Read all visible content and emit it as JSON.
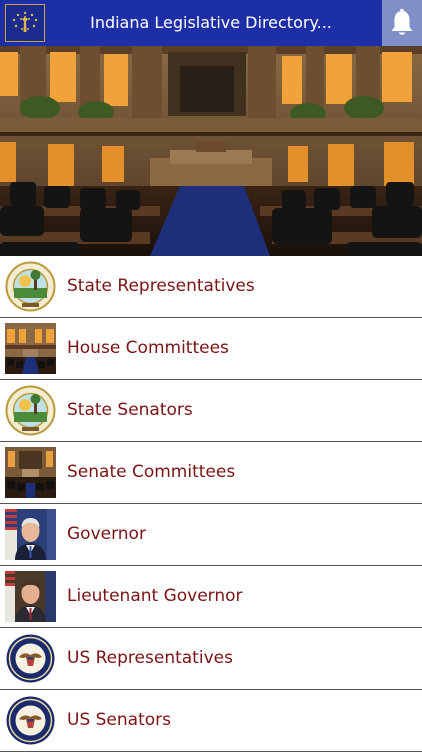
{
  "header": {
    "title": "Indiana Legislative Directory...",
    "flag_icon": "indiana-flag-icon",
    "notification_icon": "bell-icon",
    "bar_color": "#1d2fa6"
  },
  "hero": {
    "image": "indiana-house-chamber-photo",
    "carousel": {
      "pages": 2,
      "active_page": 2
    }
  },
  "menu": {
    "text_color": "#7a1414",
    "items": [
      {
        "label": "State Representatives",
        "icon": "indiana-state-seal-icon"
      },
      {
        "label": "House Committees",
        "icon": "house-chamber-photo-icon"
      },
      {
        "label": "State Senators",
        "icon": "indiana-state-seal-icon"
      },
      {
        "label": "Senate Committees",
        "icon": "senate-chamber-photo-icon"
      },
      {
        "label": "Governor",
        "icon": "governor-portrait-icon"
      },
      {
        "label": "Lieutenant Governor",
        "icon": "lieutenant-governor-portrait-icon"
      },
      {
        "label": "US Representatives",
        "icon": "us-house-seal-icon"
      },
      {
        "label": "US Senators",
        "icon": "us-senate-seal-icon"
      }
    ]
  }
}
